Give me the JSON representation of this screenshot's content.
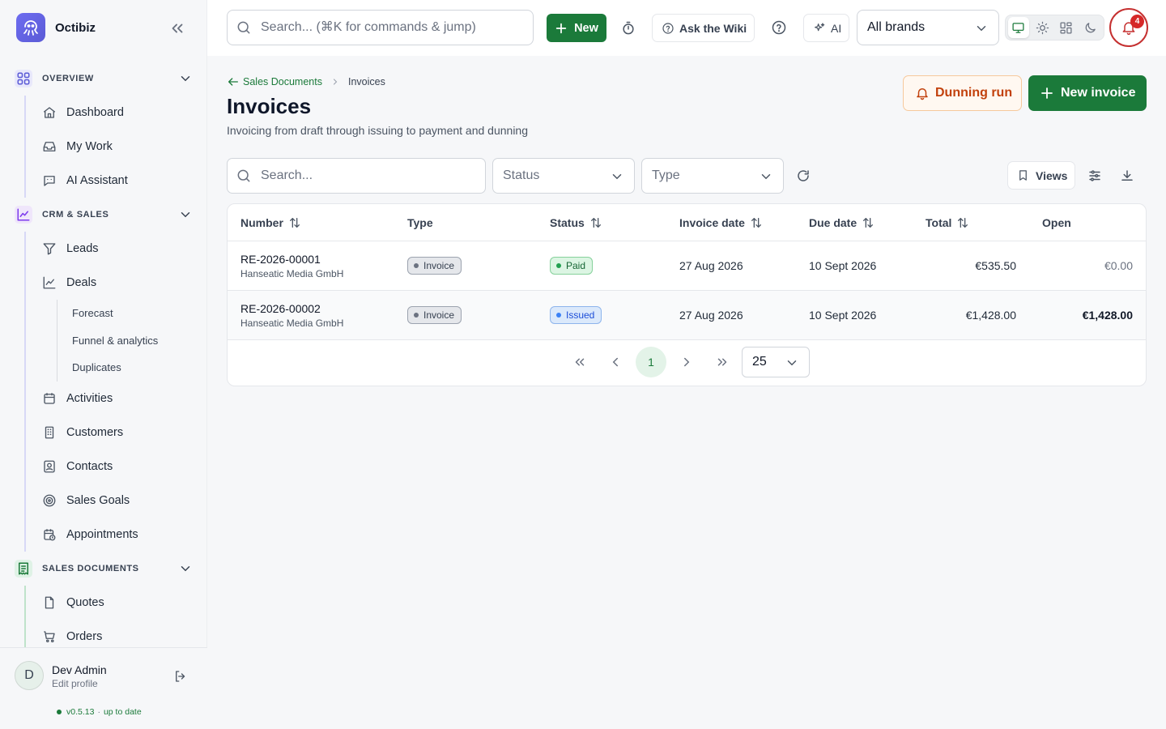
{
  "app": {
    "name": "Octibiz"
  },
  "sidebar": {
    "sections": [
      {
        "label": "OVERVIEW",
        "items": [
          {
            "label": "Dashboard"
          },
          {
            "label": "My Work"
          },
          {
            "label": "AI Assistant"
          }
        ]
      },
      {
        "label": "CRM & SALES",
        "items": [
          {
            "label": "Leads"
          },
          {
            "label": "Deals"
          },
          {
            "label": "Activities"
          },
          {
            "label": "Customers"
          },
          {
            "label": "Contacts"
          },
          {
            "label": "Sales Goals"
          },
          {
            "label": "Appointments"
          }
        ],
        "deal_subitems": [
          {
            "label": "Forecast"
          },
          {
            "label": "Funnel & analytics"
          },
          {
            "label": "Duplicates"
          }
        ]
      },
      {
        "label": "SALES DOCUMENTS",
        "items": [
          {
            "label": "Quotes"
          },
          {
            "label": "Orders"
          }
        ]
      }
    ],
    "colors": {
      "overview": "#5b5bd6",
      "crm": "#7c3aed",
      "sales_docs": "#1b7a3a"
    },
    "user": {
      "initial": "D",
      "name": "Dev Admin",
      "subtitle": "Edit profile"
    },
    "version": {
      "number": "v0.5.13",
      "separator": "·",
      "status": "up to date"
    }
  },
  "topbar": {
    "search_placeholder": "Search... (⌘K for commands & jump)",
    "new_label": "New",
    "wiki_label": "Ask the Wiki",
    "ai_label": "AI",
    "brand_select": "All brands",
    "notification_count": "4",
    "active_mode": "desktop"
  },
  "page": {
    "breadcrumb": {
      "parent": "Sales Documents",
      "current": "Invoices"
    },
    "title": "Invoices",
    "subtitle": "Invoicing from draft through issuing to payment and dunning",
    "dunning_label": "Dunning run",
    "new_invoice_label": "New invoice"
  },
  "filters": {
    "search_placeholder": "Search...",
    "status_placeholder": "Status",
    "type_placeholder": "Type",
    "views_label": "Views"
  },
  "table": {
    "columns": [
      "Number",
      "Type",
      "Status",
      "Invoice date",
      "Due date",
      "Total",
      "Open"
    ],
    "rows": [
      {
        "number": "RE-2026-00001",
        "customer": "Hanseatic Media GmbH",
        "type": "Invoice",
        "status": "Paid",
        "invoice_date": "27 Aug 2026",
        "due_date": "10 Sept 2026",
        "total": "€535.50",
        "open": "€0.00"
      },
      {
        "number": "RE-2026-00002",
        "customer": "Hanseatic Media GmbH",
        "type": "Invoice",
        "status": "Issued",
        "invoice_date": "27 Aug 2026",
        "due_date": "10 Sept 2026",
        "total": "€1,428.00",
        "open": "€1,428.00"
      }
    ],
    "pagination": {
      "current_page": "1",
      "per_page": "25"
    }
  },
  "colors": {
    "brand_green": "#1b7a3a",
    "notification_red": "#c53030",
    "dunning_orange": "#c2410c"
  }
}
